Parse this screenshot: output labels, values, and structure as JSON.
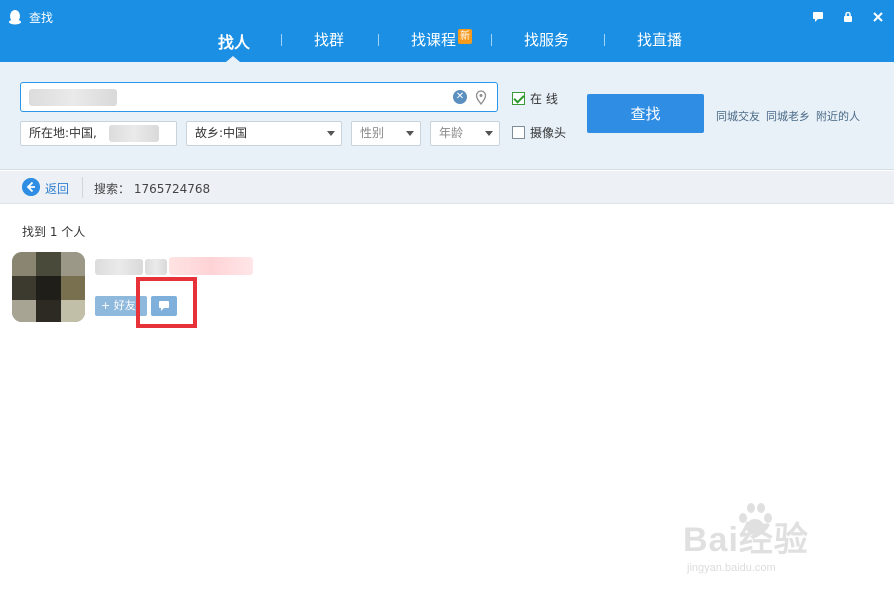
{
  "window": {
    "title": "查找"
  },
  "tabs": [
    {
      "label": "找人",
      "active": true
    },
    {
      "label": "找群",
      "active": false
    },
    {
      "label": "找课程",
      "badge": "新",
      "active": false
    },
    {
      "label": "找服务",
      "active": false
    },
    {
      "label": "找直播",
      "active": false
    }
  ],
  "search": {
    "input_value": "",
    "location_select": "所在地:中国,",
    "hometown_select": "故乡:中国",
    "gender_select": "性别",
    "age_select": "年龄",
    "online_label": "在 线",
    "online_checked": true,
    "camera_label": "摄像头",
    "camera_checked": false,
    "button_label": "查找",
    "quick_links": [
      "同城交友",
      "同城老乡",
      "附近的人"
    ]
  },
  "nav": {
    "back_label": "返回",
    "search_term": "搜索： 1765724768"
  },
  "results": {
    "count_text": "找到 1 个人",
    "add_friend_label": "+ 好友"
  },
  "watermark": {
    "brand": "Bai经验",
    "url": "jingyan.baidu.com"
  },
  "colors": {
    "accent": "#1a8fe3",
    "button": "#2f8ee4",
    "highlight": "#e8323a",
    "panel_bg": "#e8f0f8"
  },
  "icons": [
    "qq-penguin-icon",
    "feedback-icon",
    "lock-icon",
    "close-icon",
    "clear-icon",
    "location-pin-icon",
    "back-arrow-icon",
    "message-icon"
  ]
}
